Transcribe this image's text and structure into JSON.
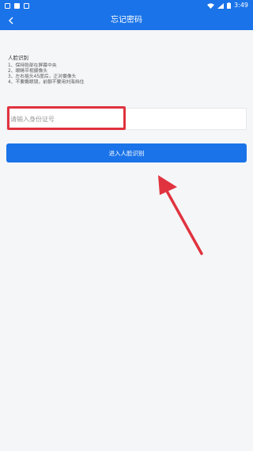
{
  "status_bar": {
    "time": "3:49"
  },
  "header": {
    "title": "忘记密码",
    "back_icon": "chevron-left-icon"
  },
  "face_section": {
    "title": "人脸识别",
    "tips": [
      "1、保持脸部在屏幕中央",
      "2、眼睛平视摄像头",
      "3、左右摇头45度后，正对摄像头",
      "4、不要戴眼镜，前额不要用刘海挡住"
    ]
  },
  "id_field": {
    "placeholder": "请输入身份证号",
    "value": ""
  },
  "submit": {
    "label": "进入人脸识别"
  },
  "colors": {
    "primary": "#1a73e8",
    "annotation": "#e0333f",
    "background": "#f5f6f8"
  }
}
